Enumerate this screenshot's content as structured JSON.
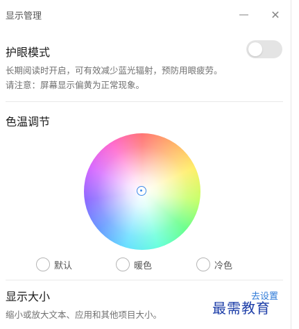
{
  "window": {
    "title": "显示管理"
  },
  "eye_protection": {
    "title": "护眼模式",
    "desc_line1": "长期阅读时开启，可有效减少蓝光辐射，预防用眼疲劳。",
    "desc_line2": "请注意：屏幕显示偏黄为正常现象。",
    "enabled": false
  },
  "color_temp": {
    "title": "色温调节",
    "options": [
      "默认",
      "暖色",
      "冷色"
    ]
  },
  "display_size": {
    "title": "显示大小",
    "link": "去设置",
    "desc": "缩小或放大文本、应用和其他项目大小。"
  },
  "watermark": "最需教育",
  "icons": {
    "minimize": "minimize-icon",
    "close": "close-icon"
  },
  "colors": {
    "accent": "#3d8be8",
    "link": "#2f7bd8",
    "toggle_off": "#e4e4e4"
  }
}
